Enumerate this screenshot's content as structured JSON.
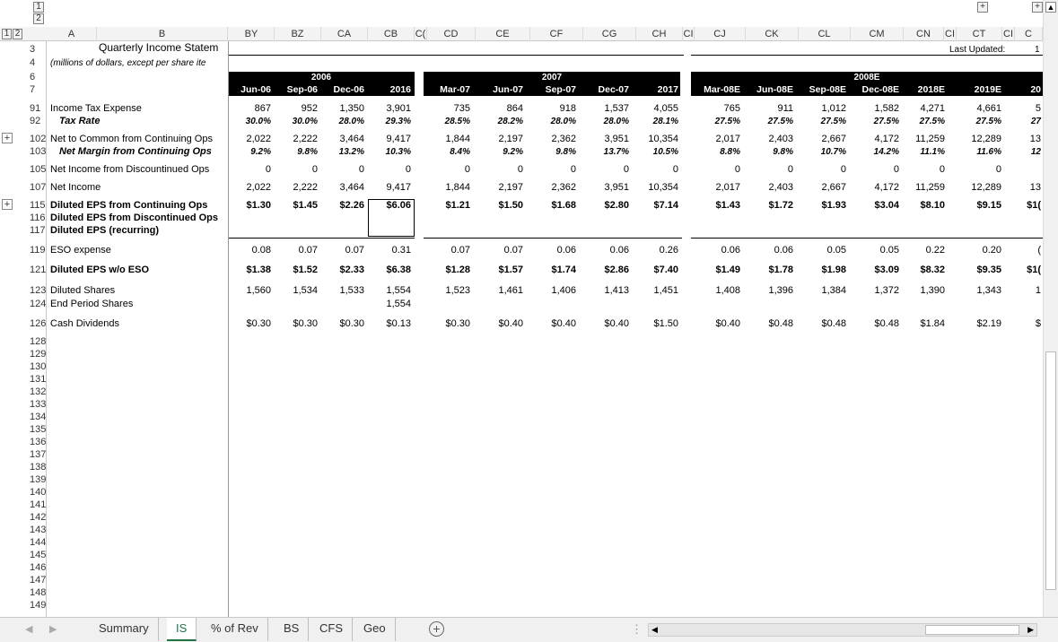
{
  "outline": {
    "levels": [
      "1",
      "2"
    ],
    "plus": "+",
    "minus": "-"
  },
  "columns": {
    "left": [
      {
        "id": "A",
        "label": "A"
      },
      {
        "id": "B",
        "label": "B"
      }
    ],
    "right": [
      {
        "id": "BY",
        "label": "BY"
      },
      {
        "id": "BZ",
        "label": "BZ"
      },
      {
        "id": "CA",
        "label": "CA"
      },
      {
        "id": "CB",
        "label": "CB"
      },
      {
        "id": "CC",
        "label": "C("
      },
      {
        "id": "CD",
        "label": "CD"
      },
      {
        "id": "CE",
        "label": "CE"
      },
      {
        "id": "CF",
        "label": "CF"
      },
      {
        "id": "CG",
        "label": "CG"
      },
      {
        "id": "CH",
        "label": "CH"
      },
      {
        "id": "CI",
        "label": "CI"
      },
      {
        "id": "CJ",
        "label": "CJ"
      },
      {
        "id": "CK",
        "label": "CK"
      },
      {
        "id": "CL",
        "label": "CL"
      },
      {
        "id": "CM",
        "label": "CM"
      },
      {
        "id": "CN",
        "label": "CN"
      },
      {
        "id": "CO",
        "label": "CI"
      },
      {
        "id": "CT",
        "label": "CT"
      },
      {
        "id": "CU",
        "label": "CI"
      },
      {
        "id": "CV",
        "label": "C"
      }
    ]
  },
  "title": "Quarterly Income Statem",
  "subtitle": "(millions of dollars, except per share ite",
  "last_updated": "Last Updated:",
  "last_updated_value": "1",
  "years": {
    "y2006": "2006",
    "y2007": "2007",
    "y2008": "2008E"
  },
  "periods": [
    "Jun-06",
    "Sep-06",
    "Dec-06",
    "2016",
    "Mar-07",
    "Jun-07",
    "Sep-07",
    "Dec-07",
    "2017",
    "Mar-08E",
    "Jun-08E",
    "Sep-08E",
    "Dec-08E",
    "2018E",
    "2019E",
    "20"
  ],
  "rows": [
    {
      "num": "91",
      "label": "Income Tax Expense",
      "style": "normal",
      "vals": [
        "867",
        "952",
        "1,350",
        "3,901",
        "735",
        "864",
        "918",
        "1,537",
        "4,055",
        "765",
        "911",
        "1,012",
        "1,582",
        "4,271",
        "4,661",
        "5"
      ]
    },
    {
      "num": "92",
      "label": "Tax Rate",
      "style": "bi-indent",
      "vals": [
        "30.0%",
        "30.0%",
        "28.0%",
        "29.3%",
        "28.5%",
        "28.2%",
        "28.0%",
        "28.0%",
        "28.1%",
        "27.5%",
        "27.5%",
        "27.5%",
        "27.5%",
        "27.5%",
        "27.5%",
        "27"
      ]
    },
    {
      "num": "102",
      "label": "Net to Common from Continuing Ops",
      "style": "normal",
      "vals": [
        "2,022",
        "2,222",
        "3,464",
        "9,417",
        "1,844",
        "2,197",
        "2,362",
        "3,951",
        "10,354",
        "2,017",
        "2,403",
        "2,667",
        "4,172",
        "11,259",
        "12,289",
        "13"
      ]
    },
    {
      "num": "103",
      "label": "Net Margin from Continuing Ops",
      "style": "bi-indent",
      "vals": [
        "9.2%",
        "9.8%",
        "13.2%",
        "10.3%",
        "8.4%",
        "9.2%",
        "9.8%",
        "13.7%",
        "10.5%",
        "8.8%",
        "9.8%",
        "10.7%",
        "14.2%",
        "11.1%",
        "11.6%",
        "12"
      ]
    },
    {
      "num": "105",
      "label": "Net Income from Discountinued Ops",
      "style": "normal",
      "vals": [
        "0",
        "0",
        "0",
        "0",
        "0",
        "0",
        "0",
        "0",
        "0",
        "0",
        "0",
        "0",
        "0",
        "0",
        "0",
        ""
      ]
    },
    {
      "num": "107",
      "label": "Net Income",
      "style": "normal",
      "vals": [
        "2,022",
        "2,222",
        "3,464",
        "9,417",
        "1,844",
        "2,197",
        "2,362",
        "3,951",
        "10,354",
        "2,017",
        "2,403",
        "2,667",
        "4,172",
        "11,259",
        "12,289",
        "13"
      ]
    },
    {
      "num": "115",
      "label": "Diluted EPS from Continuing Ops",
      "style": "bold",
      "vals": [
        "$1.30",
        "$1.45",
        "$2.26",
        "$6.06",
        "$1.21",
        "$1.50",
        "$1.68",
        "$2.80",
        "$7.14",
        "$1.43",
        "$1.72",
        "$1.93",
        "$3.04",
        "$8.10",
        "$9.15",
        "$1("
      ]
    },
    {
      "num": "116",
      "label": "Diluted EPS from Discontinued Ops",
      "style": "bold",
      "vals": [
        "",
        "",
        "",
        "",
        "",
        "",
        "",
        "",
        "",
        "",
        "",
        "",
        "",
        "",
        "",
        ""
      ]
    },
    {
      "num": "117",
      "label": "Diluted EPS (recurring)",
      "style": "bold",
      "vals": [
        "",
        "",
        "",
        "",
        "",
        "",
        "",
        "",
        "",
        "",
        "",
        "",
        "",
        "",
        "",
        ""
      ]
    },
    {
      "num": "119",
      "label": "ESO expense",
      "style": "normal",
      "vals": [
        "0.08",
        "0.07",
        "0.07",
        "0.31",
        "0.07",
        "0.07",
        "0.06",
        "0.06",
        "0.26",
        "0.06",
        "0.06",
        "0.05",
        "0.05",
        "0.22",
        "0.20",
        "("
      ]
    },
    {
      "num": "121",
      "label": "Diluted EPS w/o ESO",
      "style": "bold",
      "vals": [
        "$1.38",
        "$1.52",
        "$2.33",
        "$6.38",
        "$1.28",
        "$1.57",
        "$1.74",
        "$2.86",
        "$7.40",
        "$1.49",
        "$1.78",
        "$1.98",
        "$3.09",
        "$8.32",
        "$9.35",
        "$1("
      ]
    },
    {
      "num": "123",
      "label": "Diluted Shares",
      "style": "normal",
      "vals": [
        "1,560",
        "1,534",
        "1,533",
        "1,554",
        "1,523",
        "1,461",
        "1,406",
        "1,413",
        "1,451",
        "1,408",
        "1,396",
        "1,384",
        "1,372",
        "1,390",
        "1,343",
        "1"
      ]
    },
    {
      "num": "124",
      "label": "End Period Shares",
      "style": "normal",
      "vals": [
        "",
        "",
        "",
        "1,554",
        "",
        "",
        "",
        "",
        "",
        "",
        "",
        "",
        "",
        "",
        "",
        ""
      ]
    },
    {
      "num": "126",
      "label": "Cash Dividends",
      "style": "normal",
      "vals": [
        "$0.30",
        "$0.30",
        "$0.30",
        "$0.13",
        "$0.30",
        "$0.40",
        "$0.40",
        "$0.40",
        "$1.50",
        "$0.40",
        "$0.48",
        "$0.48",
        "$0.48",
        "$1.84",
        "$2.19",
        "$"
      ]
    }
  ],
  "empty_rows": [
    "128",
    "129",
    "130",
    "131",
    "132",
    "133",
    "134",
    "135",
    "136",
    "137",
    "138",
    "139",
    "140",
    "141",
    "142",
    "143",
    "144",
    "145",
    "146",
    "147",
    "148",
    "149"
  ],
  "sheet_tabs": {
    "active": "IS",
    "items": [
      "Summary",
      "IS",
      "% of Rev",
      "BS",
      "CFS",
      "Geo"
    ]
  },
  "add_sheet": "+",
  "colors": {
    "grid_header_bg": "#f3f3f3",
    "active_tab": "#217346",
    "band": "#000000"
  }
}
